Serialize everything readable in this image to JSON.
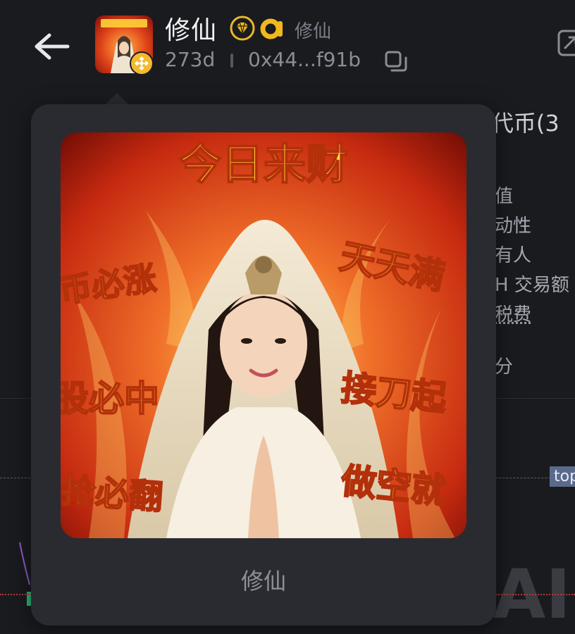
{
  "header": {
    "title": "修仙",
    "subname": "修仙",
    "age": "273d",
    "address": "0x44...f91b"
  },
  "background": {
    "title_left_fragment": "(",
    "title_right_fragment": "i代币(3",
    "list": [
      "值",
      "动性",
      "有人",
      "H 交易额",
      "税费"
    ],
    "tab_fragment": "分",
    "top_tag": "top",
    "watermark": "AI"
  },
  "popup": {
    "image_text": {
      "top": "今日来财",
      "left": [
        "币必涨",
        "股必中",
        "抢必翻"
      ],
      "right": [
        "天天满",
        "接刀起",
        "做空就"
      ]
    },
    "caption": "修仙"
  },
  "icons": {
    "back": "arrow-left-icon",
    "copy": "copy-icon",
    "external": "external-link-icon",
    "chain": "bnb-chain-icon",
    "diamond": "diamond-verified-icon",
    "a_badge": "a-badge-icon"
  },
  "colors": {
    "background": "#1a1b1f",
    "popup": "#2a2b30",
    "gold": "#f3ba2f",
    "muted": "#8a8d96"
  }
}
